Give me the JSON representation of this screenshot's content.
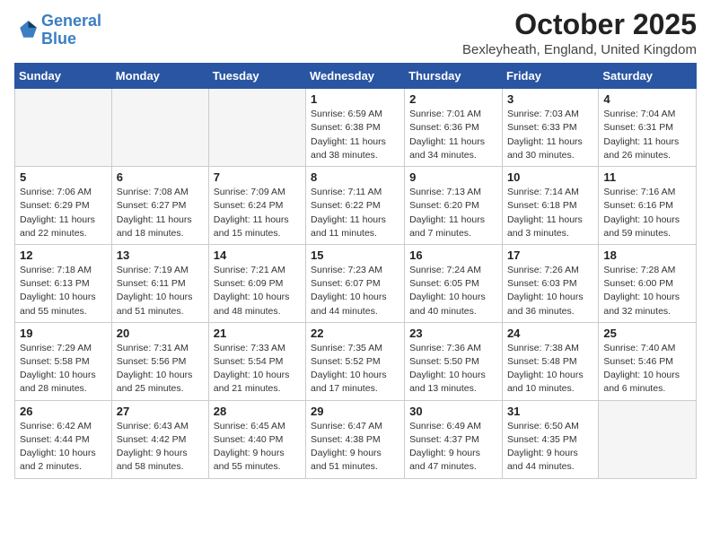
{
  "header": {
    "logo_line1": "General",
    "logo_line2": "Blue",
    "month_title": "October 2025",
    "location": "Bexleyheath, England, United Kingdom"
  },
  "days_of_week": [
    "Sunday",
    "Monday",
    "Tuesday",
    "Wednesday",
    "Thursday",
    "Friday",
    "Saturday"
  ],
  "weeks": [
    [
      {
        "day": "",
        "info": ""
      },
      {
        "day": "",
        "info": ""
      },
      {
        "day": "",
        "info": ""
      },
      {
        "day": "1",
        "info": "Sunrise: 6:59 AM\nSunset: 6:38 PM\nDaylight: 11 hours\nand 38 minutes."
      },
      {
        "day": "2",
        "info": "Sunrise: 7:01 AM\nSunset: 6:36 PM\nDaylight: 11 hours\nand 34 minutes."
      },
      {
        "day": "3",
        "info": "Sunrise: 7:03 AM\nSunset: 6:33 PM\nDaylight: 11 hours\nand 30 minutes."
      },
      {
        "day": "4",
        "info": "Sunrise: 7:04 AM\nSunset: 6:31 PM\nDaylight: 11 hours\nand 26 minutes."
      }
    ],
    [
      {
        "day": "5",
        "info": "Sunrise: 7:06 AM\nSunset: 6:29 PM\nDaylight: 11 hours\nand 22 minutes."
      },
      {
        "day": "6",
        "info": "Sunrise: 7:08 AM\nSunset: 6:27 PM\nDaylight: 11 hours\nand 18 minutes."
      },
      {
        "day": "7",
        "info": "Sunrise: 7:09 AM\nSunset: 6:24 PM\nDaylight: 11 hours\nand 15 minutes."
      },
      {
        "day": "8",
        "info": "Sunrise: 7:11 AM\nSunset: 6:22 PM\nDaylight: 11 hours\nand 11 minutes."
      },
      {
        "day": "9",
        "info": "Sunrise: 7:13 AM\nSunset: 6:20 PM\nDaylight: 11 hours\nand 7 minutes."
      },
      {
        "day": "10",
        "info": "Sunrise: 7:14 AM\nSunset: 6:18 PM\nDaylight: 11 hours\nand 3 minutes."
      },
      {
        "day": "11",
        "info": "Sunrise: 7:16 AM\nSunset: 6:16 PM\nDaylight: 10 hours\nand 59 minutes."
      }
    ],
    [
      {
        "day": "12",
        "info": "Sunrise: 7:18 AM\nSunset: 6:13 PM\nDaylight: 10 hours\nand 55 minutes."
      },
      {
        "day": "13",
        "info": "Sunrise: 7:19 AM\nSunset: 6:11 PM\nDaylight: 10 hours\nand 51 minutes."
      },
      {
        "day": "14",
        "info": "Sunrise: 7:21 AM\nSunset: 6:09 PM\nDaylight: 10 hours\nand 48 minutes."
      },
      {
        "day": "15",
        "info": "Sunrise: 7:23 AM\nSunset: 6:07 PM\nDaylight: 10 hours\nand 44 minutes."
      },
      {
        "day": "16",
        "info": "Sunrise: 7:24 AM\nSunset: 6:05 PM\nDaylight: 10 hours\nand 40 minutes."
      },
      {
        "day": "17",
        "info": "Sunrise: 7:26 AM\nSunset: 6:03 PM\nDaylight: 10 hours\nand 36 minutes."
      },
      {
        "day": "18",
        "info": "Sunrise: 7:28 AM\nSunset: 6:00 PM\nDaylight: 10 hours\nand 32 minutes."
      }
    ],
    [
      {
        "day": "19",
        "info": "Sunrise: 7:29 AM\nSunset: 5:58 PM\nDaylight: 10 hours\nand 28 minutes."
      },
      {
        "day": "20",
        "info": "Sunrise: 7:31 AM\nSunset: 5:56 PM\nDaylight: 10 hours\nand 25 minutes."
      },
      {
        "day": "21",
        "info": "Sunrise: 7:33 AM\nSunset: 5:54 PM\nDaylight: 10 hours\nand 21 minutes."
      },
      {
        "day": "22",
        "info": "Sunrise: 7:35 AM\nSunset: 5:52 PM\nDaylight: 10 hours\nand 17 minutes."
      },
      {
        "day": "23",
        "info": "Sunrise: 7:36 AM\nSunset: 5:50 PM\nDaylight: 10 hours\nand 13 minutes."
      },
      {
        "day": "24",
        "info": "Sunrise: 7:38 AM\nSunset: 5:48 PM\nDaylight: 10 hours\nand 10 minutes."
      },
      {
        "day": "25",
        "info": "Sunrise: 7:40 AM\nSunset: 5:46 PM\nDaylight: 10 hours\nand 6 minutes."
      }
    ],
    [
      {
        "day": "26",
        "info": "Sunrise: 6:42 AM\nSunset: 4:44 PM\nDaylight: 10 hours\nand 2 minutes."
      },
      {
        "day": "27",
        "info": "Sunrise: 6:43 AM\nSunset: 4:42 PM\nDaylight: 9 hours\nand 58 minutes."
      },
      {
        "day": "28",
        "info": "Sunrise: 6:45 AM\nSunset: 4:40 PM\nDaylight: 9 hours\nand 55 minutes."
      },
      {
        "day": "29",
        "info": "Sunrise: 6:47 AM\nSunset: 4:38 PM\nDaylight: 9 hours\nand 51 minutes."
      },
      {
        "day": "30",
        "info": "Sunrise: 6:49 AM\nSunset: 4:37 PM\nDaylight: 9 hours\nand 47 minutes."
      },
      {
        "day": "31",
        "info": "Sunrise: 6:50 AM\nSunset: 4:35 PM\nDaylight: 9 hours\nand 44 minutes."
      },
      {
        "day": "",
        "info": ""
      }
    ]
  ]
}
